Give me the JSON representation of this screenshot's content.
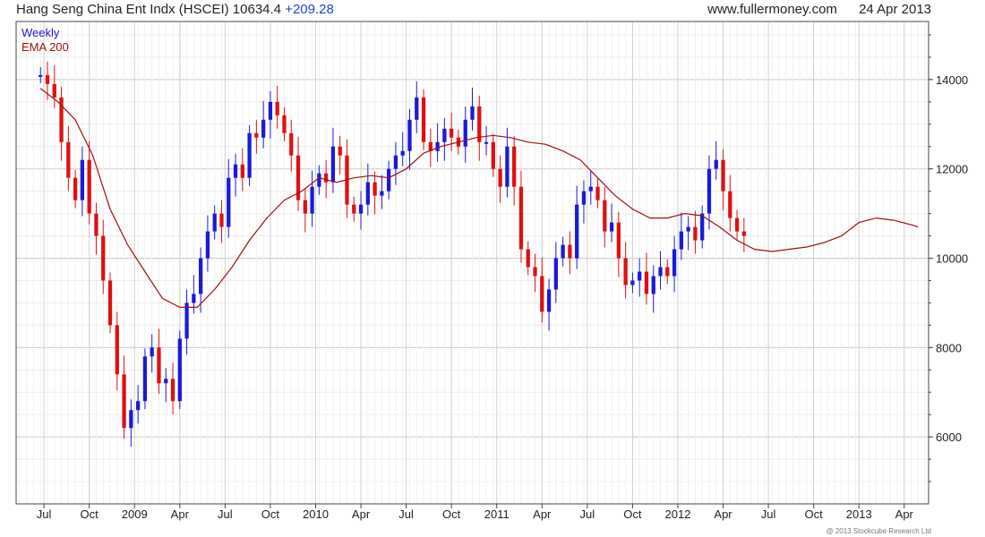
{
  "header": {
    "title": "Hang Seng China Ent Indx (HSCEI)",
    "last": "10634.4",
    "change": "+209.28",
    "site": "www.fullermoney.com",
    "date": "24 Apr 2013"
  },
  "legend": {
    "weekly": "Weekly",
    "ema": "EMA 200"
  },
  "credit": "@ 2013 Stockcube Research Ltd",
  "colors": {
    "up": "#1a1ad8",
    "down": "#e01010",
    "ema": "#a01010",
    "grid": "#d4d4d4",
    "axis": "#444444"
  },
  "chart_data": {
    "type": "line",
    "title": "Hang Seng China Ent Indx (HSCEI)",
    "xlabel": "",
    "ylabel": "",
    "ylim": [
      4500,
      15300
    ],
    "grid": true,
    "legend_position": "top-left",
    "y_ticks": [
      6000,
      8000,
      10000,
      12000,
      14000
    ],
    "x_ticks": [
      "Jul",
      "Oct",
      "2009",
      "Apr",
      "Jul",
      "Oct",
      "2010",
      "Apr",
      "Jul",
      "Oct",
      "2011",
      "Apr",
      "Jul",
      "Oct",
      "2012",
      "Apr",
      "Jul",
      "Oct",
      "2013",
      "Apr"
    ],
    "x_tick_week": [
      1,
      14,
      27,
      40,
      53,
      66,
      79,
      92,
      105,
      118,
      131,
      144,
      157,
      170,
      183,
      196,
      209,
      222,
      235,
      248
    ],
    "x_range_weeks": [
      -7,
      255
    ],
    "series": [
      {
        "name": "Weekly",
        "style": "candlestick-close",
        "week": [
          0,
          2,
          4,
          6,
          8,
          10,
          12,
          14,
          16,
          18,
          20,
          22,
          24,
          26,
          28,
          30,
          32,
          34,
          36,
          38,
          40,
          42,
          44,
          46,
          48,
          50,
          52,
          54,
          56,
          58,
          60,
          62,
          64,
          66,
          68,
          70,
          72,
          74,
          76,
          78,
          80,
          82,
          84,
          86,
          88,
          90,
          92,
          94,
          96,
          98,
          100,
          102,
          104,
          106,
          108,
          110,
          112,
          114,
          116,
          118,
          120,
          122,
          124,
          126,
          128,
          130,
          132,
          134,
          136,
          138,
          140,
          142,
          144,
          146,
          148,
          150,
          152,
          154,
          156,
          158,
          160,
          162,
          164,
          166,
          168,
          170,
          172,
          174,
          176,
          178,
          180,
          182,
          184,
          186,
          188,
          190,
          192,
          194,
          196,
          198,
          200,
          202,
          204,
          206,
          208,
          210,
          212,
          214,
          216,
          218,
          220,
          222,
          224,
          226,
          228,
          230,
          232,
          234,
          236,
          238,
          240,
          242,
          244,
          246,
          248,
          250,
          252
        ],
        "close": [
          14100,
          13900,
          13600,
          12600,
          11800,
          11300,
          12200,
          11000,
          10500,
          9500,
          8500,
          7400,
          6200,
          6600,
          6800,
          7800,
          8000,
          7200,
          7300,
          6800,
          8200,
          9000,
          9200,
          10000,
          10600,
          11000,
          10700,
          11800,
          12100,
          11800,
          12800,
          12700,
          13100,
          13500,
          13200,
          12800,
          12300,
          11300,
          11000,
          11600,
          11900,
          11700,
          12500,
          12300,
          11200,
          11000,
          11200,
          11700,
          11400,
          11500,
          12000,
          12300,
          12400,
          13100,
          13600,
          12600,
          12400,
          12600,
          12900,
          12700,
          12500,
          13100,
          13400,
          12600,
          12600,
          12000,
          11600,
          12500,
          11600,
          10200,
          9800,
          9600,
          8800,
          9300,
          10000,
          10300,
          10000,
          11200,
          11500,
          11600,
          11300,
          10600,
          10800,
          10000,
          9400,
          9500,
          9700,
          9200,
          9600,
          9800,
          9600,
          10200,
          10600,
          10700,
          10400,
          11000,
          12000,
          12200,
          11500,
          10900,
          10600,
          10500
        ]
      },
      {
        "name": "EMA 200",
        "style": "line",
        "week": [
          0,
          5,
          10,
          15,
          20,
          25,
          30,
          35,
          40,
          45,
          50,
          55,
          60,
          65,
          70,
          75,
          80,
          85,
          90,
          95,
          100,
          105,
          110,
          115,
          120,
          125,
          130,
          135,
          140,
          145,
          150,
          155,
          160,
          165,
          170,
          175,
          180,
          185,
          190,
          195,
          200,
          205,
          210,
          215,
          220,
          225,
          230,
          235,
          240,
          245,
          250,
          252
        ],
        "values": [
          13800,
          13500,
          13100,
          12300,
          11100,
          10300,
          9700,
          9100,
          8900,
          8900,
          9300,
          9800,
          10400,
          10900,
          11300,
          11500,
          11800,
          11700,
          11800,
          11850,
          11800,
          12000,
          12350,
          12500,
          12600,
          12700,
          12750,
          12700,
          12600,
          12550,
          12400,
          12200,
          11800,
          11400,
          11100,
          10900,
          10900,
          11000,
          10950,
          10700,
          10400,
          10200,
          10150,
          10200,
          10250,
          10350,
          10500,
          10800,
          10900,
          10850,
          10750,
          10700
        ]
      }
    ]
  }
}
